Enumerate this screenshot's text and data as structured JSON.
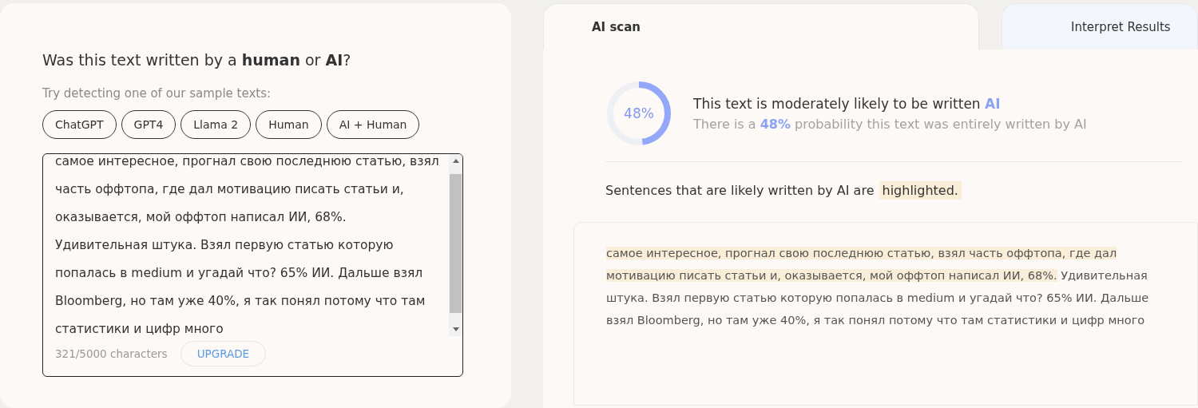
{
  "left_panel": {
    "question": "Was this text written by a **human** or **AI**?",
    "samples_label": "Try detecting one of our sample texts:",
    "samples": [
      "ChatGPT",
      "GPT4",
      "Llama 2",
      "Human",
      "AI + Human"
    ],
    "input": {
      "value": "самое интересное, прогнал свою последнюю статью, взял часть оффтопа, где дал мотивацию писать статьи и, оказывается, мой оффтоп написал ИИ, 68%. Удивительная штука. Взял первую статью которую попалась в medium и угадай что? 65% ИИ. Дальше взял Bloomberg, но там уже 40%, я так понял потому что там статистики и цифр много",
      "counter": "321/5000 characters",
      "upgrade": "UPGRADE"
    }
  },
  "tabs": [
    {
      "label": "AI scan",
      "selected": true
    },
    {
      "label": "Interpret Results",
      "selected": false
    }
  ],
  "result": {
    "gauge": {
      "label": "48%",
      "level": 0.48
    },
    "headline": "This text is moderately likely to be written **AI**",
    "detail": "There is a **48%** probability this text was entirely written by AI",
    "legend": "Sentences that are likely written by AI are",
    "legend_mark": "highlighted.",
    "sentences": [
      {
        "text": "самое интересное, прогнал свою последнюю статью, взял часть оффтопа, где дал мотивацию писать статьи и, оказывается, мой оффтоп написал ИИ, 68%.",
        "highlighted": true
      },
      {
        "text": "Удивительная штука. Взял первую статью которую попалась в medium и угадай что? 65% ИИ. Дальше взял Bloomberg, но там уже 40%, я так понял потому что там статистики и цифр много",
        "highlighted": false
      }
    ]
  }
}
